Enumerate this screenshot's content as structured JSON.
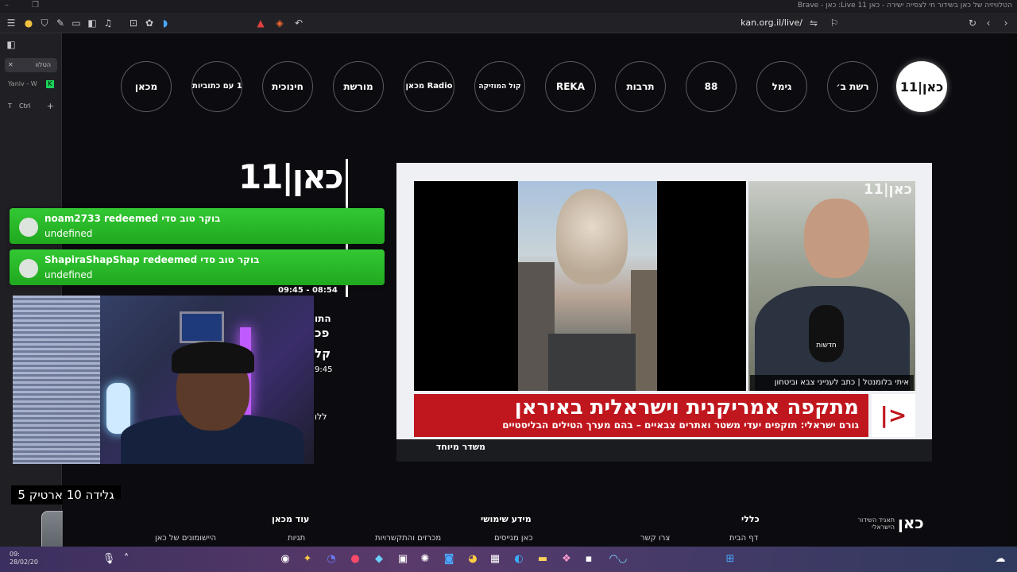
{
  "window": {
    "title": "הטלוויזיה של כאן בשידור חי לצפייה ישירה - כאן 11 Live: כאן - Brave"
  },
  "browser": {
    "url": "kan.org.il/live/"
  },
  "sidebar": {
    "tab_label": "הטלוו",
    "item_1": "Yaniv - W",
    "item_2": "Ctrl",
    "item_2_prefix": "T"
  },
  "channels": [
    {
      "label": "כאן|11",
      "active": true
    },
    {
      "label": "רשת ב׳"
    },
    {
      "label": "גימל"
    },
    {
      "label": "88"
    },
    {
      "label": "תרבות"
    },
    {
      "label": "REKA"
    },
    {
      "label": "קול המוזיקה"
    },
    {
      "label": "מכאן Radio"
    },
    {
      "label": "מורשת"
    },
    {
      "label": "חינוכית"
    },
    {
      "label": "כאן|11 עם כתוביות"
    },
    {
      "label": "מכאן"
    }
  ],
  "site": {
    "logo": "כאן|11",
    "schedule_time": "09:45 - 08:54",
    "frag_1": "התו",
    "frag_2": "פכ",
    "frag_3": "קל",
    "frag_4": "9:45",
    "frag_5": "ללו"
  },
  "player": {
    "reporter_caption": "איתי בלומנטל | כתב לענייני צבא וביטחון",
    "headline": "מתקפה אמריקנית וישראלית באיראן",
    "subheadline": "גורם ישראלי: תוקפים יעדי משטר ואתרים צבאיים – בהם מערך הטילים הבליסטיים",
    "studio_label": "משדר מיוחד",
    "mic_label": "חדשות",
    "live_logo": "כאן|11"
  },
  "alerts": [
    {
      "text": "noam2733 redeemed בוקר טוב סדי",
      "sub": "undefined"
    },
    {
      "text": "ShapiraShapShap redeemed בוקר טוב סדי",
      "sub": "undefined"
    }
  ],
  "goal": "גלידה 10 ארטיק 5",
  "footer": {
    "org": "כאן",
    "org_sub": "תאגיד השידור הישראלי",
    "headings": [
      "כללי",
      "מידע שימושי",
      "עוד מכאן"
    ],
    "links": [
      "דף הבית",
      "צרו קשר",
      "כאן מגייסים",
      "מכרזים והתקשרויות",
      "תגיות",
      "היישומונים של כאן"
    ]
  },
  "taskbar": {
    "clock_time": "09:",
    "clock_date": "28/02/20"
  }
}
